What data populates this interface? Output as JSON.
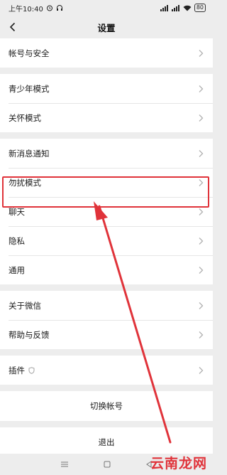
{
  "status_bar": {
    "time": "上午10:40",
    "battery": "80"
  },
  "header": {
    "title": "设置"
  },
  "groups": [
    [
      {
        "label": "帐号与安全"
      }
    ],
    [
      {
        "label": "青少年模式"
      },
      {
        "label": "关怀模式"
      }
    ],
    [
      {
        "label": "新消息通知"
      },
      {
        "label": "勿扰模式"
      },
      {
        "label": "聊天"
      },
      {
        "label": "隐私"
      },
      {
        "label": "通用"
      }
    ],
    [
      {
        "label": "关于微信"
      },
      {
        "label": "帮助与反馈"
      }
    ],
    [
      {
        "label": "插件"
      }
    ]
  ],
  "actions": {
    "switch_account": "切换帐号",
    "logout": "退出"
  },
  "watermark": "云南龙网",
  "colors": {
    "highlight": "#e0333a",
    "background": "#ededed"
  }
}
